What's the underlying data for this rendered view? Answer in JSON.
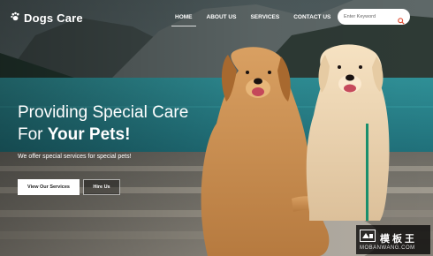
{
  "brand": {
    "name": "Dogs Care",
    "logo_icon": "paw-icon"
  },
  "nav": {
    "items": [
      {
        "label": "HOME",
        "active": true
      },
      {
        "label": "ABOUT US",
        "active": false
      },
      {
        "label": "SERVICES",
        "active": false
      },
      {
        "label": "CONTACT US",
        "active": false
      }
    ]
  },
  "search": {
    "placeholder": "Enter Keyword",
    "value": "",
    "icon": "search-icon",
    "icon_color": "#e0533a"
  },
  "hero": {
    "headline_line1": "Providing Special Care",
    "headline_line2_prefix": "For ",
    "headline_line2_bold": "Your Pets!",
    "subtext": "We offer special services for special pets!",
    "primary_button": "View Our Services",
    "secondary_button": "Hire Us"
  },
  "watermark": {
    "title": "模板王",
    "url": "MOBANWANG.COM"
  }
}
